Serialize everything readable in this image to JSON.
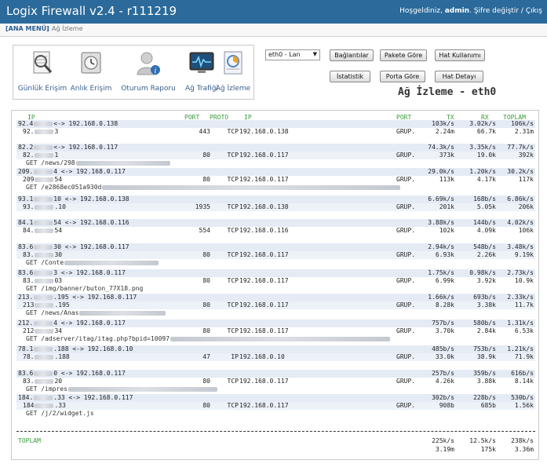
{
  "app": {
    "title": "Logix Firewall v2.4 - r111219",
    "greeting": "Hoşgeldiniz,",
    "user": "admin",
    "change_password": "Şifre değiştir",
    "sep": "/",
    "logout": "Çıkış"
  },
  "breadcrumb": {
    "menu": "[ANA MENÜ]",
    "sep": "›",
    "current": "Ağ İzleme"
  },
  "nav": [
    {
      "label": "Günlük Erişim",
      "icon": "log-magnifier-icon"
    },
    {
      "label": "Anlık Erişim",
      "icon": "clock-safe-icon"
    },
    {
      "label": "Oturum Raporu",
      "icon": "user-info-icon"
    },
    {
      "label": "Ağ Trafiği",
      "icon": "monitor-graph-icon"
    },
    {
      "label": "Ağ İzleme",
      "icon": "document-chart-icon"
    }
  ],
  "interface": {
    "selected": "eth0 - Lan"
  },
  "buttons": {
    "connections": "Bağlantılar",
    "by_packet": "Pakete Göre",
    "line_usage": "Hat Kullanımı",
    "statistics": "İstatistik",
    "by_port": "Porta Göre",
    "line_detail": "Hat Detayı"
  },
  "heading": "Ağ İzleme - eth0",
  "columns": {
    "ip": "IP",
    "port": "PORT",
    "proto": "PROTO",
    "ip2": "IP",
    "port2": "PORT",
    "tx": "TX",
    "rx": "RX",
    "total": "TOPLAM"
  },
  "flows": [
    {
      "s_ip": "92.4",
      "s_mid": "<-> 192.168.0.138",
      "s_tx": "103k/s",
      "s_rx": "3.02k/s",
      "s_tot": "106k/s",
      "d_ip": "92.",
      "d_tail": "3",
      "port": "443",
      "proto": "TCP",
      "dst": "192.168.0.138",
      "dport": "GRUP.",
      "tx": "2.24m",
      "rx": "66.7k",
      "tot": "2.31m",
      "url": ""
    },
    {
      "s_ip": "82.2",
      "s_mid": "<-> 192.168.0.117",
      "s_tx": "74.3k/s",
      "s_rx": "3.35k/s",
      "s_tot": "77.7k/s",
      "d_ip": "82.",
      "d_tail": "1",
      "port": "80",
      "proto": "TCP",
      "dst": "192.168.0.117",
      "dport": "GRUP.",
      "tx": "373k",
      "rx": "19.0k",
      "tot": "392k",
      "url": "GET /news/298"
    },
    {
      "s_ip": "209.",
      "s_mid": "4 <-> 192.168.0.117",
      "s_tx": "29.0k/s",
      "s_rx": "1.20k/s",
      "s_tot": "30.2k/s",
      "d_ip": "209",
      "d_tail": "54",
      "port": "80",
      "proto": "TCP",
      "dst": "192.168.0.117",
      "dport": "GRUP.",
      "tx": "113k",
      "rx": "4.17k",
      "tot": "117k",
      "url": "GET /e2868ec051a930d"
    },
    {
      "s_ip": "93.1",
      "s_mid": "10 <-> 192.168.0.138",
      "s_tx": "6.69k/s",
      "s_rx": "168b/s",
      "s_tot": "6.86k/s",
      "d_ip": "93.",
      "d_tail": ".10",
      "port": "1935",
      "proto": "TCP",
      "dst": "192.168.0.138",
      "dport": "GRUP.",
      "tx": "201k",
      "rx": "5.05k",
      "tot": "206k",
      "url": ""
    },
    {
      "s_ip": "84.1",
      "s_mid": "54 <-> 192.168.0.116",
      "s_tx": "3.88k/s",
      "s_rx": "144b/s",
      "s_tot": "4.02k/s",
      "d_ip": "84.",
      "d_tail": "54",
      "port": "554",
      "proto": "TCP",
      "dst": "192.168.0.116",
      "dport": "GRUP.",
      "tx": "102k",
      "rx": "4.09k",
      "tot": "106k",
      "url": ""
    },
    {
      "s_ip": "83.6",
      "s_mid": "30 <-> 192.168.0.117",
      "s_tx": "2.94k/s",
      "s_rx": "548b/s",
      "s_tot": "3.48k/s",
      "d_ip": "83.",
      "d_tail": "30",
      "port": "80",
      "proto": "TCP",
      "dst": "192.168.0.117",
      "dport": "GRUP.",
      "tx": "6.93k",
      "rx": "2.26k",
      "tot": "9.19k",
      "url": "GET /Conte"
    },
    {
      "s_ip": "83.6",
      "s_mid": "3 <-> 192.168.0.117",
      "s_tx": "1.75k/s",
      "s_rx": "0.98k/s",
      "s_tot": "2.73k/s",
      "d_ip": "83.",
      "d_tail": "03",
      "port": "80",
      "proto": "TCP",
      "dst": "192.168.0.117",
      "dport": "GRUP.",
      "tx": "6.99k",
      "rx": "3.92k",
      "tot": "10.9k",
      "url": "GET /img/banner/buton_77X18.png"
    },
    {
      "s_ip": "213.",
      "s_mid": ".195 <-> 192.168.0.117",
      "s_tx": "1.66k/s",
      "s_rx": "693b/s",
      "s_tot": "2.33k/s",
      "d_ip": "213",
      "d_tail": ".195",
      "port": "80",
      "proto": "TCP",
      "dst": "192.168.0.117",
      "dport": "GRUP.",
      "tx": "8.28k",
      "rx": "3.38k",
      "tot": "11.7k",
      "url": "GET /news/Anas"
    },
    {
      "s_ip": "212.",
      "s_mid": "4 <-> 192.168.0.117",
      "s_tx": "757b/s",
      "s_rx": "580b/s",
      "s_tot": "1.31k/s",
      "d_ip": "212",
      "d_tail": "34",
      "port": "80",
      "proto": "TCP",
      "dst": "192.168.0.117",
      "dport": "GRUP.",
      "tx": "3.70k",
      "rx": "2.84k",
      "tot": "6.53k",
      "url": "GET /adserver/itag/itag.php?bpid=10097"
    },
    {
      "s_ip": "78.1",
      "s_mid": ".188 <-> 192.168.0.10",
      "s_tx": "485b/s",
      "s_rx": "753b/s",
      "s_tot": "1.21k/s",
      "d_ip": "78.",
      "d_tail": ".188",
      "port": "47",
      "proto": "IP",
      "dst": "192.168.0.10",
      "dport": "GRUP.",
      "tx": "33.0k",
      "rx": "38.9k",
      "tot": "71.9k",
      "url": ""
    },
    {
      "s_ip": "83.6",
      "s_mid": "0 <-> 192.168.0.117",
      "s_tx": "257b/s",
      "s_rx": "359b/s",
      "s_tot": "616b/s",
      "d_ip": "83.",
      "d_tail": "20",
      "port": "80",
      "proto": "TCP",
      "dst": "192.168.0.117",
      "dport": "GRUP.",
      "tx": "4.26k",
      "rx": "3.88k",
      "tot": "8.14k",
      "url": "GET /impres"
    },
    {
      "s_ip": "184.",
      "s_mid": ".33 <-> 192.168.0.117",
      "s_tx": "302b/s",
      "s_rx": "228b/s",
      "s_tot": "530b/s",
      "d_ip": "184",
      "d_tail": ".33",
      "port": "80",
      "proto": "TCP",
      "dst": "192.168.0.117",
      "dport": "GRUP.",
      "tx": "908b",
      "rx": "685b",
      "tot": "1.56k",
      "url": "GET /j/2/widget.js"
    }
  ],
  "totals": {
    "label": "TOPLAM",
    "tx_rate": "225k/s",
    "rx_rate": "12.5k/s",
    "tot_rate": "238k/s",
    "tx": "3.19m",
    "rx": "175k",
    "tot": "3.36m"
  }
}
